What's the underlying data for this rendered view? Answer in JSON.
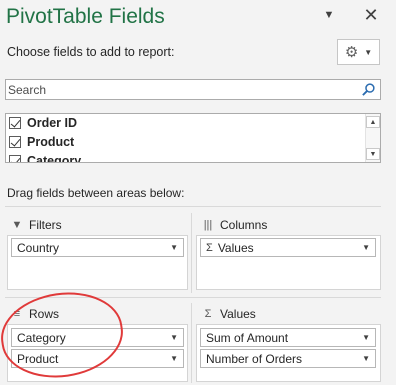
{
  "panel": {
    "title": "PivotTable Fields",
    "choose_label": "Choose fields to add to report:"
  },
  "icons": {
    "dropdown": "chevron-down-icon",
    "close": "close-icon",
    "settings": "gear-icon",
    "search": "search-icon",
    "filters": "filter-icon",
    "columns": "columns-icon",
    "rows": "rows-icon",
    "values": "sigma-icon"
  },
  "search": {
    "placeholder": "Search"
  },
  "fields": [
    {
      "label": "Order ID",
      "checked": true
    },
    {
      "label": "Product",
      "checked": true
    },
    {
      "label": "Category",
      "checked": true
    }
  ],
  "drag_label": "Drag fields between areas below:",
  "areas": {
    "filters": {
      "label": "Filters",
      "items": [
        "Country"
      ]
    },
    "columns": {
      "label": "Columns",
      "items": [
        "Values"
      ]
    },
    "rows": {
      "label": "Rows",
      "items": [
        "Category",
        "Product"
      ]
    },
    "values": {
      "label": "Values",
      "items": [
        "Sum of Amount",
        "Number of Orders"
      ]
    }
  },
  "colors": {
    "title": "#217346",
    "highlight": "#e03a3a",
    "background": "#f3f3f3"
  }
}
